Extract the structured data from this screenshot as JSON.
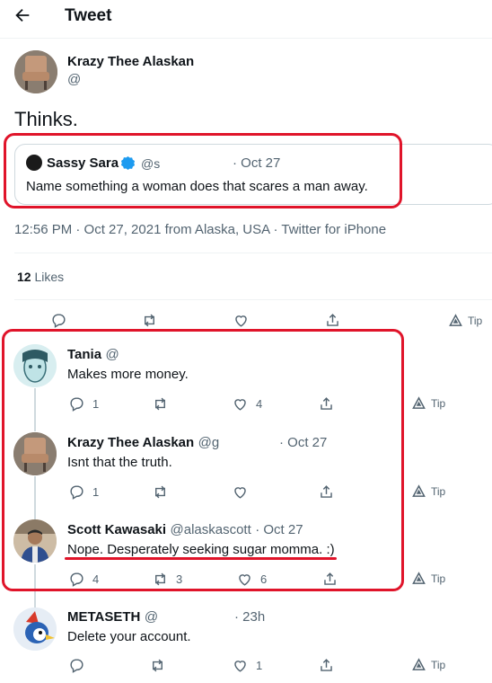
{
  "header": {
    "title": "Tweet"
  },
  "main_tweet": {
    "author_name": "Krazy Thee Alaskan",
    "author_handle": "@",
    "text": "Thinks.",
    "quoted": {
      "author_name": "Sassy Sara",
      "author_handle": "@s",
      "date": "· Oct 27",
      "text": "Name something a woman does that scares a man away."
    },
    "meta": "12:56 PM · Oct 27, 2021 from Alaska, USA · Twitter for iPhone",
    "likes_count": "12",
    "likes_label": "Likes",
    "tip_label": "Tip"
  },
  "replies": [
    {
      "author_name": "Tania",
      "author_handle": "@",
      "date": "",
      "text": "Makes more money.",
      "reply_count": "1",
      "retweet_count": "",
      "like_count": "4",
      "tip_label": "Tip"
    },
    {
      "author_name": "Krazy Thee Alaskan",
      "author_handle": "@g",
      "date": "· Oct 27",
      "text": "Isnt that the truth.",
      "reply_count": "1",
      "retweet_count": "",
      "like_count": "",
      "tip_label": "Tip"
    },
    {
      "author_name": "Scott Kawasaki",
      "author_handle": "@alaskascott",
      "date": "· Oct 27",
      "text": "Nope. Desperately seeking sugar momma. :)",
      "reply_count": "4",
      "retweet_count": "3",
      "like_count": "6",
      "tip_label": "Tip"
    },
    {
      "author_name": "METASETH",
      "author_handle": "@",
      "date": "· 23h",
      "text": "Delete your account.",
      "reply_count": "",
      "retweet_count": "",
      "like_count": "1",
      "tip_label": "Tip"
    }
  ],
  "colors": {
    "highlight": "#e0142a",
    "verified": "#1d9bf0"
  }
}
